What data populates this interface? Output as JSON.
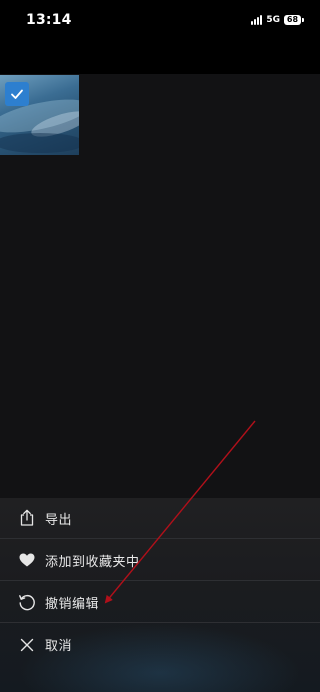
{
  "status_bar": {
    "time": "13:14",
    "network": "5G",
    "battery": "68"
  },
  "gallery": {
    "thumbnail": {
      "selected": true,
      "icon": "checkmark-icon"
    }
  },
  "menu": {
    "items": [
      {
        "label": "导出",
        "icon": "share-icon"
      },
      {
        "label": "添加到收藏夹中",
        "icon": "heart-icon"
      },
      {
        "label": "撤销编辑",
        "icon": "undo-icon"
      },
      {
        "label": "取消",
        "icon": "close-icon"
      }
    ]
  },
  "annotation": {
    "color": "#b0101a"
  },
  "colors": {
    "accent": "#2d7fcf",
    "sheet_background": "#1f2023"
  }
}
